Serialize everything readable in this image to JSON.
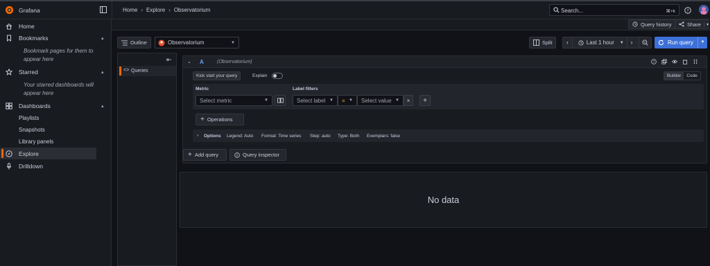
{
  "app": {
    "name": "Grafana"
  },
  "breadcrumb": {
    "home": "Home",
    "explore": "Explore",
    "current": "Observatorium",
    "sep": "›"
  },
  "search": {
    "placeholder": "Search...",
    "shortcut": "⌘+k"
  },
  "subbar": {
    "query_history": "Query history",
    "share": "Share"
  },
  "sidebar": {
    "home": "Home",
    "bookmarks": "Bookmarks",
    "bookmarks_hint": "Bookmark pages for them to appear here",
    "starred": "Starred",
    "starred_hint": "Your starred dashboards will appear here",
    "dashboards": "Dashboards",
    "playlists": "Playlists",
    "snapshots": "Snapshots",
    "library_panels": "Library panels",
    "explore": "Explore",
    "drilldown": "Drilldown"
  },
  "toolbar": {
    "outline": "Outline",
    "datasource": "Observatorium",
    "split": "Split",
    "time_range": "Last 1 hour",
    "run_query": "Run query"
  },
  "outline_panel": {
    "queries": "Queries"
  },
  "query": {
    "letter": "A",
    "datasource": "(Observatorium)",
    "kick_start": "Kick start your query",
    "explain": "Explain",
    "builder": "Builder",
    "code": "Code",
    "metric_label": "Metric",
    "metric_placeholder": "Select metric",
    "label_filters": "Label filters",
    "select_label": "Select label",
    "operator": "=",
    "select_value": "Select value",
    "operations": "Operations",
    "options": "Options",
    "legend": "Legend: Auto",
    "format": "Format: Time series",
    "step": "Step: auto",
    "type": "Type: Both",
    "exemplars": "Exemplars: false"
  },
  "actions": {
    "add_query": "Add query",
    "query_inspector": "Query inspector"
  },
  "result": {
    "no_data": "No data"
  },
  "colors": {
    "accent": "#3d71d9",
    "active": "#f46800",
    "bg": "#111217",
    "panel": "#181b1f"
  }
}
